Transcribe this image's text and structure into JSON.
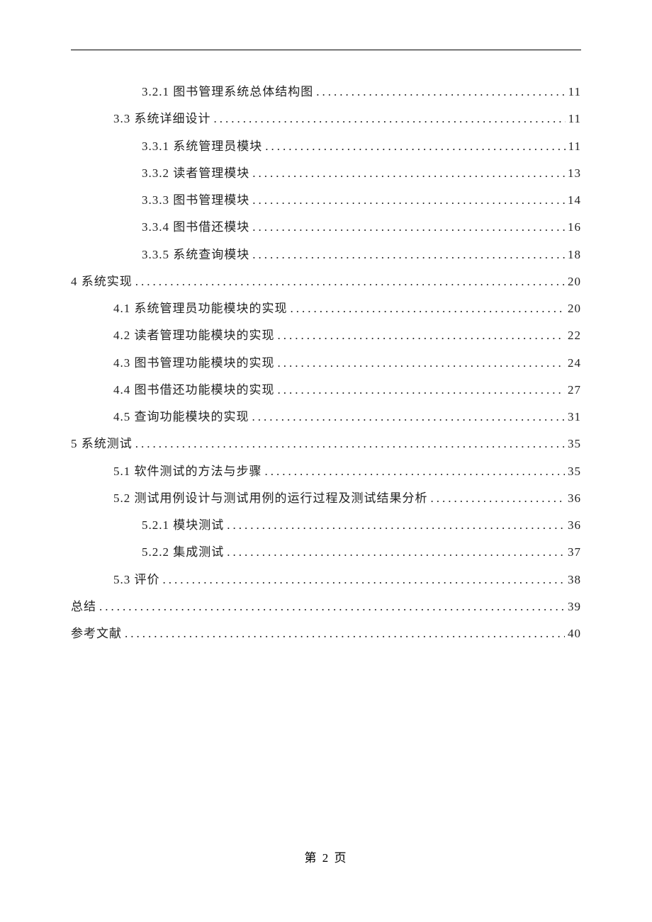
{
  "toc": {
    "entries": [
      {
        "level": 2,
        "label": "3.2.1 图书管理系统总体结构图",
        "page": "11"
      },
      {
        "level": 1,
        "label": "3.3 系统详细设计",
        "page": "11"
      },
      {
        "level": 2,
        "label": "3.3.1 系统管理员模块",
        "page": "11"
      },
      {
        "level": 2,
        "label": "3.3.2 读者管理模块",
        "page": "13"
      },
      {
        "level": 2,
        "label": "3.3.3 图书管理模块",
        "page": "14"
      },
      {
        "level": 2,
        "label": "3.3.4 图书借还模块",
        "page": "16"
      },
      {
        "level": 2,
        "label": "3.3.5 系统查询模块",
        "page": "18"
      },
      {
        "level": 0,
        "label": "4 系统实现",
        "page": "20"
      },
      {
        "level": 1,
        "label": "4.1 系统管理员功能模块的实现",
        "page": "20"
      },
      {
        "level": 1,
        "label": "4.2 读者管理功能模块的实现",
        "page": "22"
      },
      {
        "level": 1,
        "label": "4.3 图书管理功能模块的实现",
        "page": "24"
      },
      {
        "level": 1,
        "label": "4.4 图书借还功能模块的实现",
        "page": "27"
      },
      {
        "level": 1,
        "label": "4.5 查询功能模块的实现",
        "page": "31"
      },
      {
        "level": 0,
        "label": "5 系统测试",
        "page": "35"
      },
      {
        "level": 1,
        "label": "5.1 软件测试的方法与步骤",
        "page": "35"
      },
      {
        "level": 1,
        "label": "5.2 测试用例设计与测试用例的运行过程及测试结果分析",
        "page": "36"
      },
      {
        "level": 2,
        "label": "5.2.1 模块测试",
        "page": "36"
      },
      {
        "level": 2,
        "label": "5.2.2 集成测试",
        "page": "37"
      },
      {
        "level": 1,
        "label": "5.3 评价",
        "page": "38"
      },
      {
        "level": 0,
        "label": "总结",
        "page": "39"
      },
      {
        "level": 0,
        "label": "参考文献",
        "page": "40"
      }
    ]
  },
  "footer": {
    "page_label": "第 2 页"
  }
}
